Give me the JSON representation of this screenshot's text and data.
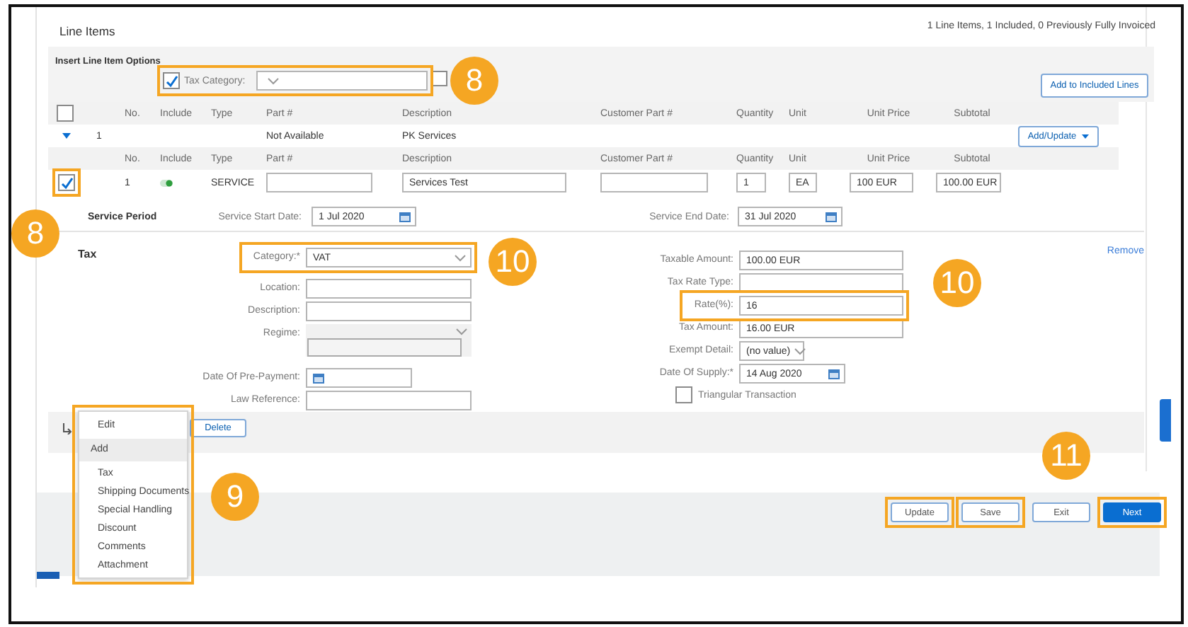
{
  "section_title": "Line Items",
  "summary": "1 Line Items,  1 Included,  0 Previously Fully Invoiced",
  "options": {
    "title": "Insert Line Item Options",
    "tax_category": {
      "label": "Tax Category:",
      "checked": true,
      "highlighted": true
    },
    "second_checkbox": {
      "checked": false
    },
    "add_button": "Add to Included Lines"
  },
  "columns": [
    "No.",
    "Include",
    "Type",
    "Part #",
    "Description",
    "Customer Part #",
    "Quantity",
    "Unit",
    "Unit Price",
    "Subtotal"
  ],
  "header_checkbox": {
    "checked": false
  },
  "parent_row": {
    "expanded": true,
    "no": "1",
    "part": "Not Available",
    "description": "PK Services",
    "action": "Add/Update"
  },
  "item_columns": [
    "No.",
    "Include",
    "Type",
    "Part #",
    "Description",
    "Customer Part #",
    "Quantity",
    "Unit",
    "Unit Price",
    "Subtotal"
  ],
  "item": {
    "checked": true,
    "highlighted": true,
    "no": "1",
    "include": true,
    "type": "SERVICE",
    "description": "Services Test",
    "quantity": "1",
    "unit": "EA",
    "unit_price": "100 EUR",
    "subtotal": "100.00 EUR"
  },
  "service_period": {
    "title": "Service Period",
    "start_label": "Service Start Date:",
    "start": "1 Jul 2020",
    "end_label": "Service End Date:",
    "end": "31 Jul 2020"
  },
  "tax": {
    "title": "Tax",
    "remove": "Remove",
    "left_fields": [
      {
        "kind": "select",
        "label": "Category:*",
        "value": "VAT",
        "highlighted": true
      },
      {
        "kind": "text",
        "label": "Location:",
        "highlighted": false
      },
      {
        "kind": "text",
        "label": "Description:",
        "highlighted": false
      },
      {
        "kind": "regime",
        "label": "Regime:",
        "highlighted": false
      },
      {
        "kind": "date",
        "label": "Date Of Pre-Payment:",
        "highlighted": false
      },
      {
        "kind": "text",
        "label": "Law Reference:",
        "highlighted": false
      }
    ],
    "right_fields": [
      {
        "kind": "text",
        "label": "Taxable Amount:",
        "value": "100.00 EUR",
        "highlighted": false
      },
      {
        "kind": "text",
        "label": "Tax Rate Type:",
        "highlighted": false
      },
      {
        "kind": "text",
        "label": "Rate(%):",
        "value": "16",
        "highlighted": true
      },
      {
        "kind": "text",
        "label": "Tax Amount:",
        "value": "16.00 EUR",
        "highlighted": false
      },
      {
        "kind": "select",
        "label": "Exempt Detail:",
        "value": "(no value)",
        "highlighted": false
      },
      {
        "kind": "date",
        "label": "Date Of Supply:*",
        "value": "14 Aug 2020",
        "highlighted": false
      },
      {
        "kind": "checkbox",
        "label": "Triangular Transaction",
        "checked": false,
        "highlighted": false
      }
    ]
  },
  "action_bar": {
    "delete": "Delete"
  },
  "menu": {
    "highlighted": true,
    "items": [
      {
        "kind": "action",
        "label": "Edit"
      },
      {
        "kind": "header",
        "label": "Add"
      },
      {
        "kind": "sub",
        "label": "Tax"
      },
      {
        "kind": "sub",
        "label": "Shipping Documents"
      },
      {
        "kind": "sub",
        "label": "Special Handling"
      },
      {
        "kind": "sub",
        "label": "Discount"
      },
      {
        "kind": "sub",
        "label": "Comments"
      },
      {
        "kind": "sub",
        "label": "Attachment"
      }
    ]
  },
  "buttons": [
    {
      "label": "Update",
      "primary": false,
      "highlighted": true
    },
    {
      "label": "Save",
      "primary": false,
      "highlighted": true
    },
    {
      "label": "Exit",
      "primary": false,
      "highlighted": false
    },
    {
      "label": "Next",
      "primary": true,
      "highlighted": true
    }
  ],
  "callouts": [
    {
      "number": "8"
    },
    {
      "number": "8"
    },
    {
      "number": "10"
    },
    {
      "number": "10"
    },
    {
      "number": "9"
    },
    {
      "number": "11"
    }
  ]
}
